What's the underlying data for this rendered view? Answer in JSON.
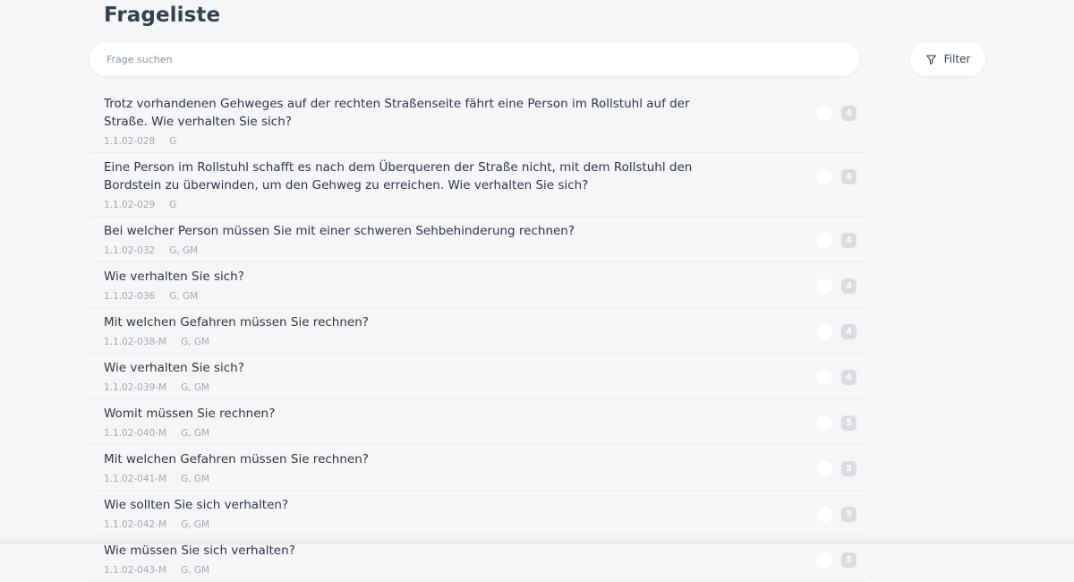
{
  "page": {
    "title": "Frageliste"
  },
  "search": {
    "placeholder": "Frage suchen",
    "value": ""
  },
  "filter": {
    "label": "Filter",
    "icon": "filter-icon"
  },
  "colors": {
    "background": "#f5f6f8",
    "text": "#2f3642",
    "meta": "#a3a9b1",
    "badge": "#d9dce0"
  },
  "questions": [
    {
      "text": "Trotz vorhandenen Gehweges auf der rechten Straßenseite fährt eine Person im Rollstuhl auf der Straße. Wie verhalten Sie sich?",
      "code": "1.1.02-028",
      "classes": "G",
      "points": "4"
    },
    {
      "text": "Eine Person im Rollstuhl schafft es nach dem Überqueren der Straße nicht, mit dem Rollstuhl den Bordstein zu überwinden, um den Gehweg zu erreichen. Wie verhalten Sie sich?",
      "code": "1.1.02-029",
      "classes": "G",
      "points": "4"
    },
    {
      "text": "Bei welcher Person müssen Sie mit einer schweren Sehbehinderung rechnen?",
      "code": "1.1.02-032",
      "classes": "G, GM",
      "points": "4"
    },
    {
      "text": "Wie verhalten Sie sich?",
      "code": "1.1.02-036",
      "classes": "G, GM",
      "points": "4"
    },
    {
      "text": "Mit welchen Gefahren müssen Sie rechnen?",
      "code": "1.1.02-038-M",
      "classes": "G, GM",
      "points": "4"
    },
    {
      "text": "Wie verhalten Sie sich?",
      "code": "1.1.02-039-M",
      "classes": "G, GM",
      "points": "4"
    },
    {
      "text": "Womit müssen Sie rechnen?",
      "code": "1.1.02-040-M",
      "classes": "G, GM",
      "points": "5"
    },
    {
      "text": "Mit welchen Gefahren müssen Sie rechnen?",
      "code": "1.1.02-041-M",
      "classes": "G, GM",
      "points": "5"
    },
    {
      "text": "Wie sollten Sie sich verhalten?",
      "code": "1.1.02-042-M",
      "classes": "G, GM",
      "points": "5"
    },
    {
      "text": "Wie müssen Sie sich verhalten?",
      "code": "1.1.02-043-M",
      "classes": "G, GM",
      "points": "5"
    }
  ]
}
